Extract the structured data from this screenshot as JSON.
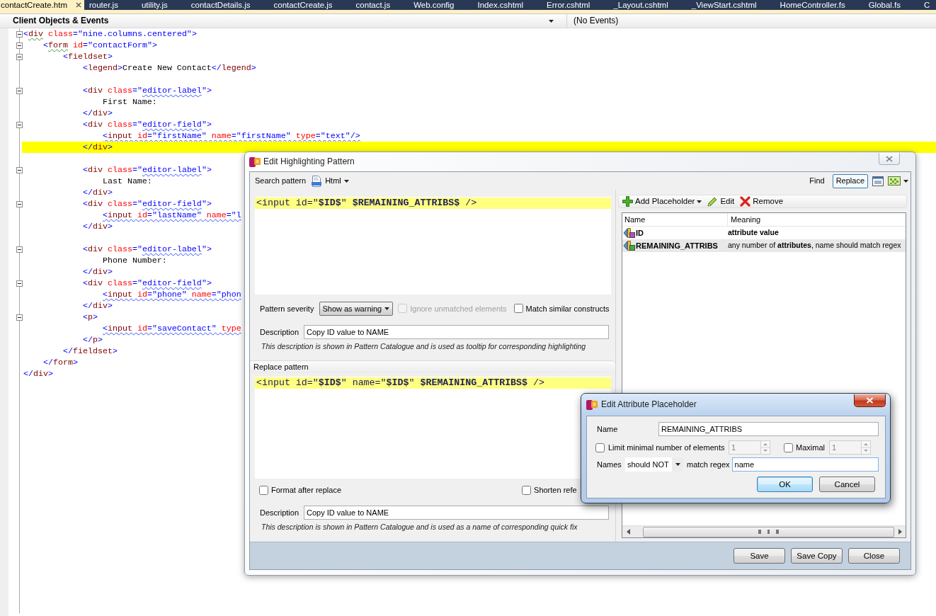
{
  "tabs": [
    {
      "label": "contactCreate.htm",
      "selected": true
    },
    {
      "label": "router.js",
      "selected": false
    },
    {
      "label": "utility.js",
      "selected": false
    },
    {
      "label": "contactDetails.js",
      "selected": false
    },
    {
      "label": "contactCreate.js",
      "selected": false
    },
    {
      "label": "contact.js",
      "selected": false
    },
    {
      "label": "Web.config",
      "selected": false
    },
    {
      "label": "Index.cshtml",
      "selected": false
    },
    {
      "label": "Error.cshtml",
      "selected": false
    },
    {
      "label": "_Layout.cshtml",
      "selected": false
    },
    {
      "label": "_ViewStart.cshtml",
      "selected": false
    },
    {
      "label": "HomeController.fs",
      "selected": false
    },
    {
      "label": "Global.fs",
      "selected": false
    },
    {
      "label": "C",
      "selected": false
    }
  ],
  "navigation": {
    "objects": "Client Objects & Events",
    "events": "(No Events)"
  },
  "editor": {
    "blocks": [
      [
        {
          "text": "<div class=\"nine.columns.centered\">",
          "fold": true,
          "highlighted": false,
          "tag_squiggle": true
        },
        {
          "text": "    <form id=\"contactForm\">",
          "fold": true,
          "highlighted": false,
          "tag_squiggle": true
        },
        {
          "text": "        <fieldset>",
          "fold": true,
          "highlighted": false
        },
        {
          "text": "            <legend>Create New Contact</legend>",
          "fold": false,
          "highlighted": false
        }
      ],
      [
        {
          "text": "            <div class=\"editor-label\">",
          "fold": true,
          "highlighted": false,
          "value_squiggle": true
        },
        {
          "text": "                First Name:",
          "fold": false,
          "highlighted": false
        },
        {
          "text": "            </div>",
          "fold": false,
          "highlighted": false
        },
        {
          "text": "            <div class=\"editor-field\">",
          "fold": true,
          "highlighted": false,
          "value_squiggle": true
        },
        {
          "text": "                <input id=\"firstName\" name=\"firstName\" type=\"text\"/>",
          "fold": false,
          "highlighted": false,
          "element_squiggle": true
        },
        {
          "text": "            </div>",
          "fold": false,
          "highlighted": true
        }
      ],
      [
        {
          "text": "            <div class=\"editor-label\">",
          "fold": true,
          "highlighted": false,
          "value_squiggle": true
        },
        {
          "text": "                Last Name:",
          "fold": false,
          "highlighted": false
        },
        {
          "text": "            </div>",
          "fold": false,
          "highlighted": false
        },
        {
          "text": "            <div class=\"editor-field\">",
          "fold": true,
          "highlighted": false,
          "value_squiggle": true
        },
        {
          "text": "                <input id=\"lastName\" name=\"l",
          "fold": false,
          "highlighted": false,
          "element_squiggle": true
        },
        {
          "text": "            </div>",
          "fold": false,
          "highlighted": false
        }
      ],
      [
        {
          "text": "            <div class=\"editor-label\">",
          "fold": true,
          "highlighted": false,
          "value_squiggle": true
        },
        {
          "text": "                Phone Number:",
          "fold": false,
          "highlighted": false
        },
        {
          "text": "            </div>",
          "fold": false,
          "highlighted": false
        },
        {
          "text": "            <div class=\"editor-field\">",
          "fold": true,
          "highlighted": false,
          "value_squiggle": true
        },
        {
          "text": "                <input id=\"phone\" name=\"phon",
          "fold": false,
          "highlighted": false,
          "element_squiggle": true
        },
        {
          "text": "            </div>",
          "fold": false,
          "highlighted": false
        },
        {
          "text": "            <p>",
          "fold": true,
          "highlighted": false
        },
        {
          "text": "                <input id=\"saveContact\" type",
          "fold": false,
          "highlighted": false,
          "element_squiggle": true
        },
        {
          "text": "            </p>",
          "fold": false,
          "highlighted": false
        },
        {
          "text": "        </fieldset>",
          "fold": false,
          "highlighted": false
        },
        {
          "text": "    </form>",
          "fold": false,
          "highlighted": false
        },
        {
          "text": "</div>",
          "fold": false,
          "highlighted": false
        }
      ]
    ]
  },
  "pattern_dialog": {
    "title": "Edit Highlighting Pattern",
    "search_label": "Search pattern",
    "language": "Html",
    "modes": [
      {
        "label": "Find",
        "selected": false
      },
      {
        "label": "Replace",
        "selected": true
      }
    ],
    "search_editor": [
      {
        "text": "<input id=\"**$ID$**\" **$REMAINING_ATTRIBS$** />",
        "highlighted": true
      }
    ],
    "severity": {
      "label": "Pattern severity",
      "value": "Show as warning"
    },
    "search_options": [
      {
        "label": "Ignore unmatched elements",
        "checked": false,
        "disabled": true
      },
      {
        "label": "Match similar constructs",
        "checked": false,
        "disabled": false
      }
    ],
    "search_description": {
      "label": "Description",
      "value": "Copy ID value to NAME",
      "note": "This description is shown in Pattern Catalogue and is used as tooltip for corresponding highlighting"
    },
    "replace_label": "Replace pattern",
    "replace_editor": [
      {
        "text": "<input id=\"**$ID$**\" name=\"**$ID$**\" **$REMAINING_ATTRIBS$** />",
        "highlighted": true
      }
    ],
    "replace_options": [
      {
        "label": "Format after replace",
        "checked": false
      },
      {
        "label": "Shorten refe",
        "checked": false
      }
    ],
    "replace_description": {
      "label": "Description",
      "value": "Copy ID value to NAME",
      "note": "This description is shown in Pattern Catalogue and is used as a name of corresponding quick fix"
    },
    "toolbar": [
      {
        "label": "Add Placeholder",
        "kind": "add"
      },
      {
        "label": "Edit",
        "kind": "edit"
      },
      {
        "label": "Remove",
        "kind": "remove"
      }
    ],
    "placeholders": {
      "columns": [
        "Name",
        "Meaning"
      ],
      "rows": [
        {
          "name": "ID",
          "meaning": "attribute value",
          "kind": "value",
          "selected": false
        },
        {
          "name": "REMAINING_ATTRIBS",
          "meaning": "any number of **attributes**, name should match regex",
          "kind": "attributes",
          "selected": true
        }
      ]
    },
    "buttons": [
      "Save",
      "Save Copy",
      "Close"
    ]
  },
  "attribute_dialog": {
    "title": "Edit Attribute Placeholder",
    "name": {
      "label": "Name",
      "value": "REMAINING_ATTRIBS"
    },
    "minimum": {
      "label": "Limit minimal number of elements",
      "checked": false,
      "value": "1",
      "disabled": true
    },
    "maximum": {
      "label": "Maximal",
      "checked": false,
      "value": "1",
      "disabled": true
    },
    "names": {
      "label": "Names",
      "condition": "should NOT",
      "regex_label": "match regex",
      "regex": "name"
    },
    "buttons": [
      {
        "label": "OK",
        "default": true
      },
      {
        "label": "Cancel",
        "default": false
      }
    ]
  }
}
